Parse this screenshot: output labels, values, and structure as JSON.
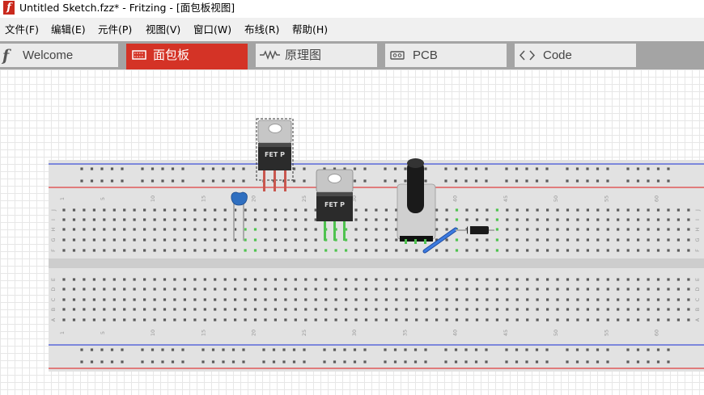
{
  "window": {
    "title": "Untitled Sketch.fzz* - Fritzing - [面包板视图]",
    "app_icon": "f"
  },
  "menu": [
    "文件(F)",
    "编辑(E)",
    "元件(P)",
    "视图(V)",
    "窗口(W)",
    "布线(R)",
    "帮助(H)"
  ],
  "tabs": [
    {
      "label": "Welcome",
      "icon": "fritzing-f-icon",
      "active": false
    },
    {
      "label": "面包板",
      "icon": "breadboard-icon",
      "active": true
    },
    {
      "label": "原理图",
      "icon": "resistor-icon",
      "active": false
    },
    {
      "label": "PCB",
      "icon": "pcb-icon",
      "active": false
    },
    {
      "label": "Code",
      "icon": "code-icon",
      "active": false
    }
  ],
  "breadboard": {
    "column_numbers": [
      "1",
      "5",
      "10",
      "15",
      "20",
      "25",
      "30",
      "35",
      "40",
      "45",
      "50",
      "55",
      "60"
    ],
    "row_letters_top": [
      "J",
      "I",
      "H",
      "G",
      "F"
    ],
    "row_letters_bottom": [
      "E",
      "D",
      "C",
      "B",
      "A"
    ]
  },
  "parts": {
    "fet1_label": "FET P",
    "fet2_label": "FET P"
  },
  "colors": {
    "accent": "#d43326",
    "tab_bar": "#a4a4a4",
    "rail_blue": "#3f51d8",
    "rail_red": "#e04040",
    "connected_hole": "#4fc24f",
    "capacitor": "#2f6fc0",
    "wire": "#2f6fd6"
  }
}
